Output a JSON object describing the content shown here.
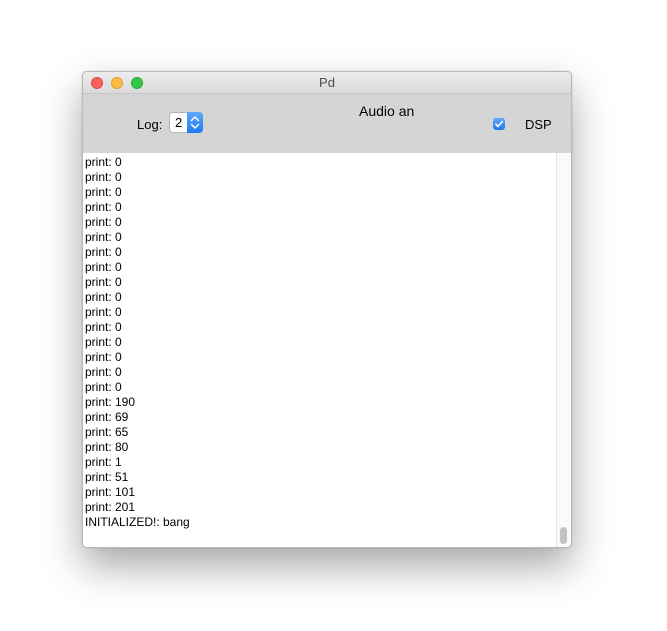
{
  "window": {
    "title": "Pd"
  },
  "toolbar": {
    "log_label": "Log:",
    "log_value": "2",
    "audio_status": "Audio an",
    "dsp_checked": true,
    "dsp_label": "DSP"
  },
  "console": {
    "lines": [
      "print: 0",
      "print: 0",
      "print: 0",
      "print: 0",
      "print: 0",
      "print: 0",
      "print: 0",
      "print: 0",
      "print: 0",
      "print: 0",
      "print: 0",
      "print: 0",
      "print: 0",
      "print: 0",
      "print: 0",
      "print: 0",
      "print: 190",
      "print: 69",
      "print: 65",
      "print: 80",
      "print: 1",
      "print: 51",
      "print: 101",
      "print: 201",
      "INITIALIZED!: bang"
    ]
  },
  "colors": {
    "accent": "#1d7cf2",
    "toolbar_bg": "#d5d5d5",
    "close": "#fc605c",
    "minimize": "#fdbc40",
    "maximize": "#34c84a"
  }
}
